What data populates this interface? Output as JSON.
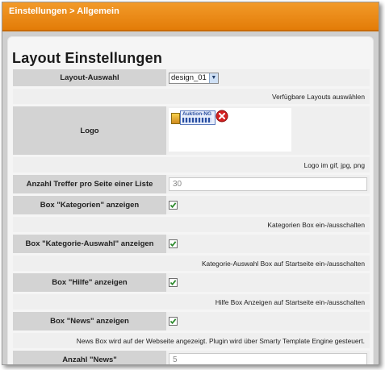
{
  "header": {
    "title": "Einstellungen > Allgemein"
  },
  "page": {
    "title": "Layout Einstellungen"
  },
  "rows": {
    "layout": {
      "label": "Layout-Auswahl",
      "selected": "design_01",
      "hint": "Verfügbare Layouts auswählen"
    },
    "logo": {
      "label": "Logo",
      "image_text": "Auktion-NG",
      "hint": "Logo im gif, jpg, png"
    },
    "hits": {
      "label": "Anzahl Treffer pro Seite einer Liste",
      "value": "30"
    },
    "categories": {
      "label": "Box \"Kategorien\" anzeigen",
      "checked": true,
      "hint": "Kategorien Box ein-/ausschalten"
    },
    "category_select": {
      "label": "Box \"Kategorie-Auswahl\" anzeigen",
      "checked": true,
      "hint": "Kategorie-Auswahl Box auf Startseite ein-/ausschalten"
    },
    "help": {
      "label": "Box \"Hilfe\" anzeigen",
      "checked": true,
      "hint": "Hilfe Box Anzeigen auf Startseite ein-/ausschalten"
    },
    "news": {
      "label": "Box \"News\" anzeigen",
      "checked": true,
      "hint": "News Box wird auf der Webseite angezeigt. Plugin wird über Smarty Template Engine gesteuert."
    },
    "news_count": {
      "label": "Anzahl \"News\"",
      "value": "5"
    }
  },
  "colors": {
    "header_orange": "#e37c08",
    "label_cell": "#d3d3d3",
    "value_cell": "#efefef",
    "check_green": "#2d8a2d",
    "delete_red": "#d42020"
  },
  "icons": {
    "select_arrow": "chevron-down-icon",
    "checkbox_mark": "checkmark-icon",
    "logo_delete": "delete-x-icon"
  }
}
